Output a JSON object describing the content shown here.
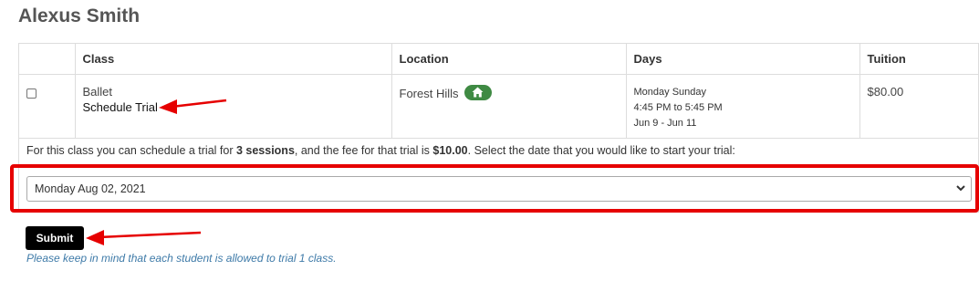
{
  "student": {
    "name": "Alexus Smith"
  },
  "table": {
    "headers": {
      "class": "Class",
      "location": "Location",
      "days": "Days",
      "tuition": "Tuition"
    },
    "row": {
      "selected": false,
      "class_name": "Ballet",
      "schedule_trial_label": "Schedule Trial",
      "location": "Forest Hills",
      "location_badge_icon": "home-icon",
      "days": "Monday Sunday",
      "time": "4:45 PM to 5:45 PM",
      "dates": "Jun 9 - Jun 11",
      "tuition": "$80.00"
    }
  },
  "trial": {
    "text_before_sessions": "For this class you can schedule a trial for ",
    "sessions": "3 sessions",
    "text_before_fee": ", and the fee for that trial is ",
    "fee": "$10.00",
    "text_after_fee": ". Select the date that you would like to start your trial:",
    "selected_date": "Monday Aug 02, 2021"
  },
  "form": {
    "submit_label": "Submit",
    "note": "Please keep in mind that each student is allowed to trial 1 class."
  },
  "colors": {
    "annotation_red": "#e60000",
    "badge_green": "#3f8a43",
    "note_blue": "#3e7aa8"
  }
}
